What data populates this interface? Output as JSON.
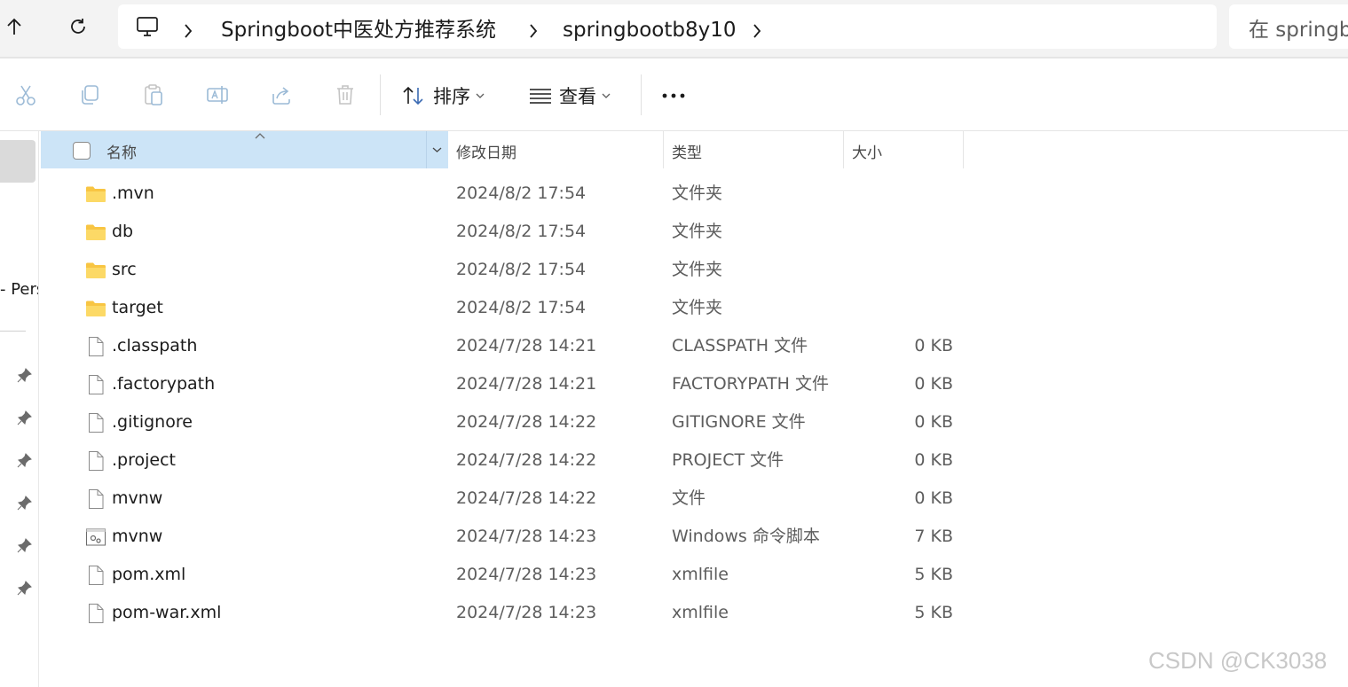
{
  "address": {
    "crumbs": [
      "Springboot中医处方推荐系统",
      "springbootb8y10"
    ],
    "search_placeholder": "在 springb"
  },
  "toolbar": {
    "sort_label": "排序",
    "view_label": "查看",
    "more_label": "···"
  },
  "nav": {
    "clipped_item": "- Pers"
  },
  "columns": {
    "name": "名称",
    "date": "修改日期",
    "type": "类型",
    "size": "大小"
  },
  "files": [
    {
      "name": ".mvn",
      "date": "2024/8/2 17:54",
      "type": "文件夹",
      "size": "",
      "icon": "folder-icon"
    },
    {
      "name": "db",
      "date": "2024/8/2 17:54",
      "type": "文件夹",
      "size": "",
      "icon": "folder-icon"
    },
    {
      "name": "src",
      "date": "2024/8/2 17:54",
      "type": "文件夹",
      "size": "",
      "icon": "folder-icon"
    },
    {
      "name": "target",
      "date": "2024/8/2 17:54",
      "type": "文件夹",
      "size": "",
      "icon": "folder-icon"
    },
    {
      "name": ".classpath",
      "date": "2024/7/28 14:21",
      "type": "CLASSPATH 文件",
      "size": "0 KB",
      "icon": "file-icon"
    },
    {
      "name": ".factorypath",
      "date": "2024/7/28 14:21",
      "type": "FACTORYPATH 文件",
      "size": "0 KB",
      "icon": "file-icon"
    },
    {
      "name": ".gitignore",
      "date": "2024/7/28 14:22",
      "type": "GITIGNORE 文件",
      "size": "0 KB",
      "icon": "file-icon"
    },
    {
      "name": ".project",
      "date": "2024/7/28 14:22",
      "type": "PROJECT 文件",
      "size": "0 KB",
      "icon": "file-icon"
    },
    {
      "name": "mvnw",
      "date": "2024/7/28 14:22",
      "type": "文件",
      "size": "0 KB",
      "icon": "file-icon"
    },
    {
      "name": "mvnw",
      "date": "2024/7/28 14:23",
      "type": "Windows 命令脚本",
      "size": "7 KB",
      "icon": "script-file-icon"
    },
    {
      "name": "pom.xml",
      "date": "2024/7/28 14:23",
      "type": "xmlfile",
      "size": "5 KB",
      "icon": "file-icon"
    },
    {
      "name": "pom-war.xml",
      "date": "2024/7/28 14:23",
      "type": "xmlfile",
      "size": "5 KB",
      "icon": "file-icon"
    }
  ],
  "watermark": "CSDN @CK3038",
  "colors": {
    "header_selected": "#cce4f7",
    "folder": "#f8c543",
    "muted_text": "#5d5d5d"
  }
}
